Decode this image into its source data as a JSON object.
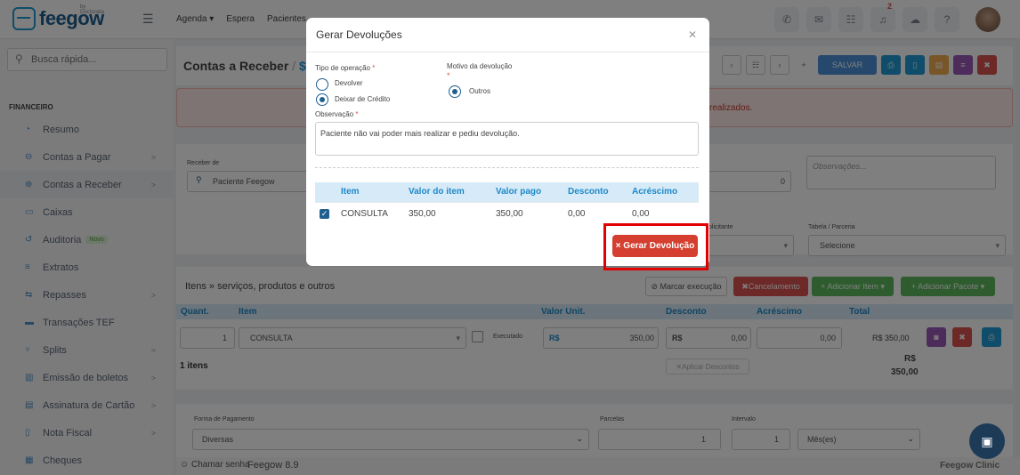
{
  "header": {
    "logo_text": "feegow",
    "logo_sub": "by Doctoralia",
    "nav": [
      "Agenda ▾",
      "Espera",
      "Pacientes"
    ],
    "notification_count": "2"
  },
  "sidebar": {
    "search_placeholder": "Busca rápida...",
    "section_title": "FINANCEIRO",
    "items": [
      {
        "label": "Resumo",
        "chevron": ""
      },
      {
        "label": "Contas a Pagar",
        "chevron": ">"
      },
      {
        "label": "Contas a Receber",
        "chevron": ">"
      },
      {
        "label": "Caixas",
        "chevron": ""
      },
      {
        "label": "Auditoria",
        "chevron": "",
        "badge": "Novo"
      },
      {
        "label": "Extratos",
        "chevron": ""
      },
      {
        "label": "Repasses",
        "chevron": ">"
      },
      {
        "label": "Transações TEF",
        "chevron": ""
      },
      {
        "label": "Splits",
        "chevron": ">"
      },
      {
        "label": "Emissão de boletos",
        "chevron": ">"
      },
      {
        "label": "Assinatura de Cartão",
        "chevron": ">"
      },
      {
        "label": "Nota Fiscal",
        "chevron": ">"
      },
      {
        "label": "Cheques",
        "chevron": ""
      }
    ]
  },
  "page": {
    "title": "Contas a Receber",
    "title_sep": "/",
    "title_suffix": "$",
    "save_label": "SALVAR",
    "alert_text": "realizados.",
    "receber_de_label": "Receber de",
    "patient": "Paciente Feegow",
    "obs_placeholder": "Observações...",
    "zero": "0",
    "tabela_label": "Tabela / Parceria",
    "tabela_value": "Selecione",
    "solicitante_label": "olicitante",
    "itens_title": "Itens » serviços, produtos e outros",
    "marcar_label": "Marcar execução",
    "cancelamento_label": "Cancelamento",
    "add_item_label": "+ Adicionar Item ▾",
    "add_pacote_label": "+ Adicionar Pacote ▾",
    "cols": [
      "Quant.",
      "Item",
      "Valor Unit.",
      "Desconto",
      "Acréscimo",
      "Total"
    ],
    "row": {
      "qty": "1",
      "item": "CONSULTA",
      "executado": "Executado",
      "currency": "R$",
      "valor": "350,00",
      "desconto": "0,00",
      "acrescimo": "0,00",
      "total": "R$ 350,00"
    },
    "count": "1 itens",
    "aplicar_label": "Aplicar Descontos",
    "grand_currency": "R$",
    "grand_total": "350,00",
    "forma_label": "Forma de Pagamento",
    "forma_value": "Diversas",
    "parcelas_label": "Parcelas",
    "parcelas_value": "1",
    "intervalo_label": "Intervalo",
    "intervalo_value": "1",
    "periodo_value": "Mês(es)"
  },
  "footer": {
    "chamar_label": "Chamar senha",
    "version": "Feegow 8.9",
    "brand": "Feegow Clinic"
  },
  "modal": {
    "title": "Gerar Devoluções",
    "tipo_label": "Tipo de operação",
    "option_devolver": "Devolver",
    "option_credito": "Deixar de Crédito",
    "motivo_label": "Motivo da devolução",
    "option_outros": "Outros",
    "obs_label": "Observação",
    "obs_value": "Paciente não vai poder mais realizar e pediu devolução.",
    "table_headers": [
      "Item",
      "Valor do item",
      "Valor pago",
      "Desconto",
      "Acréscimo"
    ],
    "table_row": {
      "item": "CONSULTA",
      "valor_item": "350,00",
      "valor_pago": "350,00",
      "desconto": "0,00",
      "acrescimo": "0,00"
    },
    "submit_label": "× Gerar Devolução"
  },
  "colors": {
    "primary": "#1f5f8f",
    "accent": "#1e9bd7",
    "danger": "#d43f2f",
    "highlight": "#e00000"
  }
}
